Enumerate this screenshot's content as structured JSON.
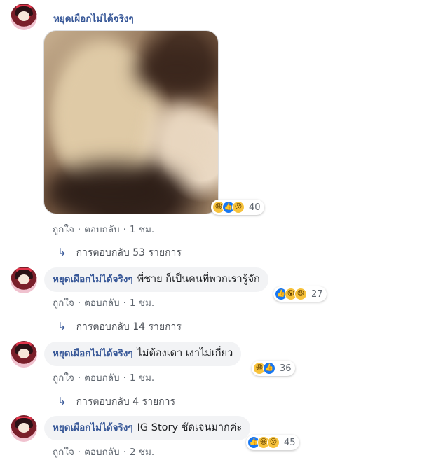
{
  "author": "หยุดเผือกไม่ได้จริงๆ",
  "labels": {
    "like": "ถูกใจ",
    "reply": "ตอบกลับ",
    "sep": "·"
  },
  "reaction_colors": {
    "like": "#1877f2",
    "haha": "#f7c23b",
    "wow": "#f7c23b"
  },
  "comments": [
    {
      "type": "photo",
      "time": "1 ชม.",
      "reactions": [
        "haha-icon",
        "like-icon",
        "wow-icon"
      ],
      "reaction_count": "40",
      "replies": "การตอบกลับ 53 รายการ"
    },
    {
      "type": "text",
      "text": "พี่ชาย ก็เป็นคนที่พวกเรารู้จัก",
      "time": "1 ชม.",
      "reactions": [
        "like-icon",
        "wow-icon",
        "haha-icon"
      ],
      "reaction_count": "27",
      "replies": "การตอบกลับ 14 รายการ"
    },
    {
      "type": "text",
      "text": "ไม่ต้องเดา เงาไม่เกี่ยว",
      "time": "1 ชม.",
      "reactions": [
        "haha-icon",
        "like-icon"
      ],
      "reaction_count": "36",
      "replies": "การตอบกลับ 4 รายการ"
    },
    {
      "type": "text",
      "text": "IG Story ชัดเจนมากค่ะ",
      "time": "2 ชม.",
      "reactions": [
        "like-icon",
        "haha-icon",
        "wow-icon"
      ],
      "reaction_count": "45"
    }
  ]
}
